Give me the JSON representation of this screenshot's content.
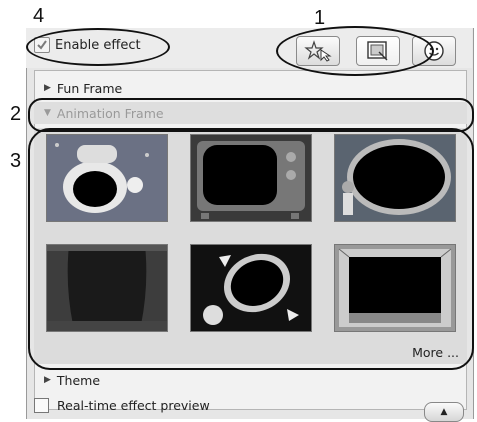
{
  "callouts": {
    "c1": "1",
    "c2": "2",
    "c3": "3",
    "c4": "4"
  },
  "header": {
    "enable_label": "Enable effect"
  },
  "tabs": [
    {
      "icon": "star-cursor-icon"
    },
    {
      "icon": "frame-photo-icon"
    },
    {
      "icon": "smiley-icon"
    }
  ],
  "categories": {
    "fun_frame": "Fun Frame",
    "animation_frame": "Animation Frame",
    "theme": "Theme"
  },
  "thumbnails": [
    {
      "name": "frame-thumb-cartoon"
    },
    {
      "name": "frame-thumb-tv"
    },
    {
      "name": "frame-thumb-vase"
    },
    {
      "name": "frame-thumb-curtain"
    },
    {
      "name": "frame-thumb-rocket"
    },
    {
      "name": "frame-thumb-window"
    }
  ],
  "more_label": "More ...",
  "footer": {
    "preview_label": "Real-time effect preview"
  },
  "colors": {
    "panel_bg": "#e6e6e6",
    "list_bg": "#f2f2f2",
    "disabled_text": "#9a9a9a"
  }
}
